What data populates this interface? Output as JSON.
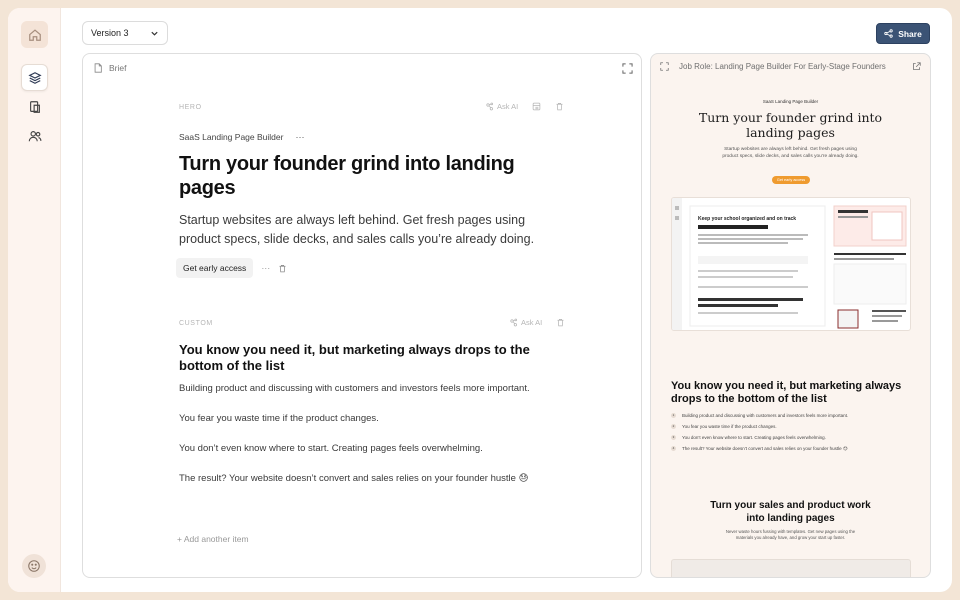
{
  "sidebar": {
    "items": [
      {
        "icon": "home-icon"
      },
      {
        "icon": "layers-icon",
        "active": true
      },
      {
        "icon": "pages-icon"
      },
      {
        "icon": "users-icon"
      }
    ],
    "bottom_icon": "smiley-icon"
  },
  "toolbar": {
    "version_label": "Version 3",
    "share_label": "Share"
  },
  "editor": {
    "brief_label": "Brief",
    "hero": {
      "section_label": "HERO",
      "ask_ai_label": "Ask AI",
      "eyebrow": "SaaS Landing Page Builder",
      "more_glyph": "···",
      "title": "Turn your founder grind into landing pages",
      "subtitle": "Startup websites are always left behind. Get fresh pages using product specs, slide decks, and sales calls you’re already doing.",
      "cta_label": "Get early access"
    },
    "custom": {
      "section_label": "CUSTOM",
      "ask_ai_label": "Ask AI",
      "title": "You know you need it, but marketing always drops to the bottom of the list",
      "paragraphs": [
        "Building product and discussing with customers and investors feels more important.",
        "You fear you waste time if the product changes.",
        "You don’t even know where to start. Creating pages feels overwhelming.",
        "The result? Your website doesn’t convert and sales relies on your founder hustle 😓"
      ]
    },
    "add_item_label": "+ Add another item"
  },
  "preview": {
    "title": "Job Role: Landing Page Builder For Early-Stage Founders",
    "eyebrow": "SaaS Landing Page Builder",
    "headline": "Turn your founder grind into landing pages",
    "subtitle": "Startup websites are always left behind. Get fresh pages using product specs, slide decks, and sales calls you’re already doing.",
    "cta": "Get early access",
    "shot_heading": "Keep your school organized and on track",
    "section2_title": "You know you need it, but marketing always drops to the bottom of the list",
    "list_items": [
      "Building product and discussing with customers and investors feels more important.",
      "You fear you waste time if the product changes.",
      "You don’t even know where to start. Creating pages feels overwhelming.",
      "The result? Your website doesn’t convert and sales relies on your founder hustle 😓"
    ],
    "section3_title": "Turn your sales and product work into landing pages",
    "section3_sub": "Never waste hours fussing with templates. Get new pages using the materials you already have, and grow your start up faster."
  },
  "colors": {
    "share_bg": "#3b5375",
    "cta_orange": "#ef9b2f",
    "page_bg": "#f3e5d6"
  }
}
